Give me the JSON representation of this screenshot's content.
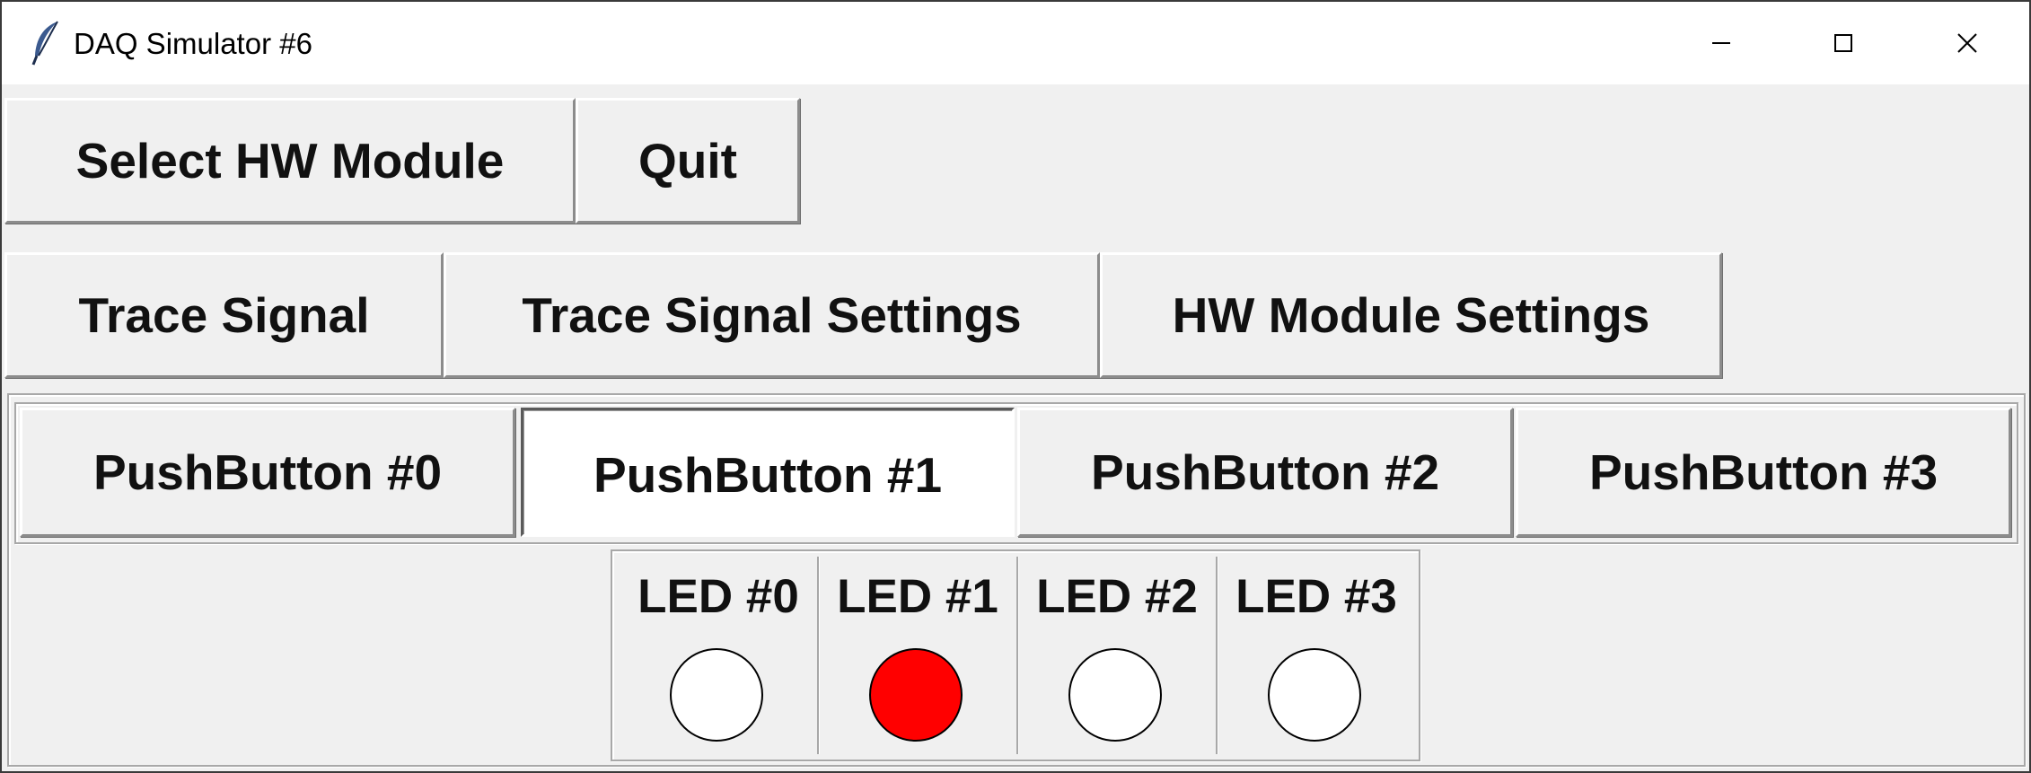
{
  "window": {
    "title": "DAQ Simulator #6",
    "controls": {
      "minimize": "minimize-icon",
      "maximize": "maximize-icon",
      "close": "close-icon"
    }
  },
  "toolbar_row1": {
    "select_hw_module": "Select HW Module",
    "quit": "Quit"
  },
  "toolbar_row2": {
    "trace_signal": "Trace Signal",
    "trace_signal_settings": "Trace Signal Settings",
    "hw_module_settings": "HW Module Settings"
  },
  "push_buttons": [
    {
      "label": "PushButton #0",
      "pressed": false
    },
    {
      "label": "PushButton #1",
      "pressed": true
    },
    {
      "label": "PushButton #2",
      "pressed": false
    },
    {
      "label": "PushButton #3",
      "pressed": false
    }
  ],
  "leds": [
    {
      "label": "LED #0",
      "on": false,
      "color": "#ffffff"
    },
    {
      "label": "LED #1",
      "on": true,
      "color": "#ff0000"
    },
    {
      "label": "LED #2",
      "on": false,
      "color": "#ffffff"
    },
    {
      "label": "LED #3",
      "on": false,
      "color": "#ffffff"
    }
  ],
  "colors": {
    "background": "#f0f0f0",
    "led_on": "#ff0000",
    "led_off": "#ffffff"
  }
}
